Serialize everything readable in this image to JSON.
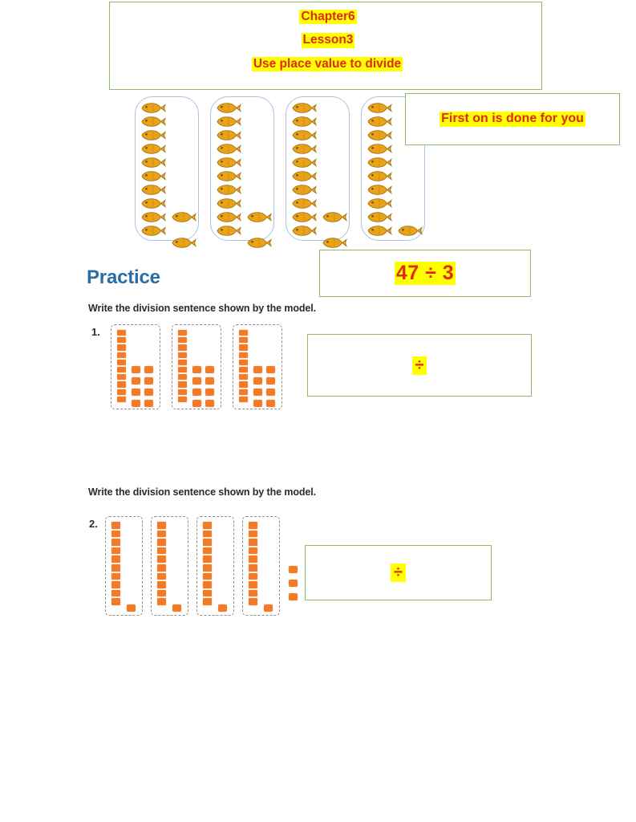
{
  "page": {
    "title": "Chapter 6 Lesson 3 Use place value to divide worksheet",
    "background_color": "#ffffff"
  },
  "colors": {
    "annotation_border": "#8fb96c",
    "highlight": "#ffff00",
    "annotation_text": "#e02a10",
    "heading_blue": "#2b6ca3",
    "block_orange": "#f47a28",
    "fish_gold": "#e8a317",
    "group_outline_blue": "#a8c4e2",
    "dashed_gray": "#8d8d8d"
  },
  "header_box": {
    "line_1": "Chapter6",
    "line_2": "Lesson3",
    "line_3": "Use place value to divide"
  },
  "note_box": {
    "text": "First on is done for you"
  },
  "expression_box": {
    "text": "47 ÷ 3"
  },
  "fish_model": {
    "groups": [
      {
        "column_count": 10,
        "extra_count": 2
      },
      {
        "column_count": 10,
        "extra_count": 2
      },
      {
        "column_count": 10,
        "extra_count": 2
      },
      {
        "column_count": 10,
        "extra_count": 1
      }
    ],
    "total_fish": 47,
    "icon": "fish-icon"
  },
  "practice": {
    "heading": "Practice",
    "problems": [
      {
        "number": "1.",
        "instruction": "Write the division sentence shown by the model.",
        "model": {
          "groups": [
            {
              "rods": 1,
              "rod_segments": 10,
              "units": 8
            },
            {
              "rods": 1,
              "rod_segments": 10,
              "units": 8
            },
            {
              "rods": 1,
              "rod_segments": 10,
              "units": 8
            }
          ],
          "loose_units": 0
        },
        "answer_box": {
          "text": "÷"
        }
      },
      {
        "number": "2.",
        "instruction": "Write the division sentence shown by the model.",
        "model": {
          "groups": [
            {
              "rods": 1,
              "rod_segments": 10,
              "units": 1
            },
            {
              "rods": 1,
              "rod_segments": 10,
              "units": 1
            },
            {
              "rods": 1,
              "rod_segments": 10,
              "units": 1
            },
            {
              "rods": 1,
              "rod_segments": 10,
              "units": 1
            }
          ],
          "loose_units": 3
        },
        "answer_box": {
          "text": "÷"
        }
      }
    ]
  }
}
